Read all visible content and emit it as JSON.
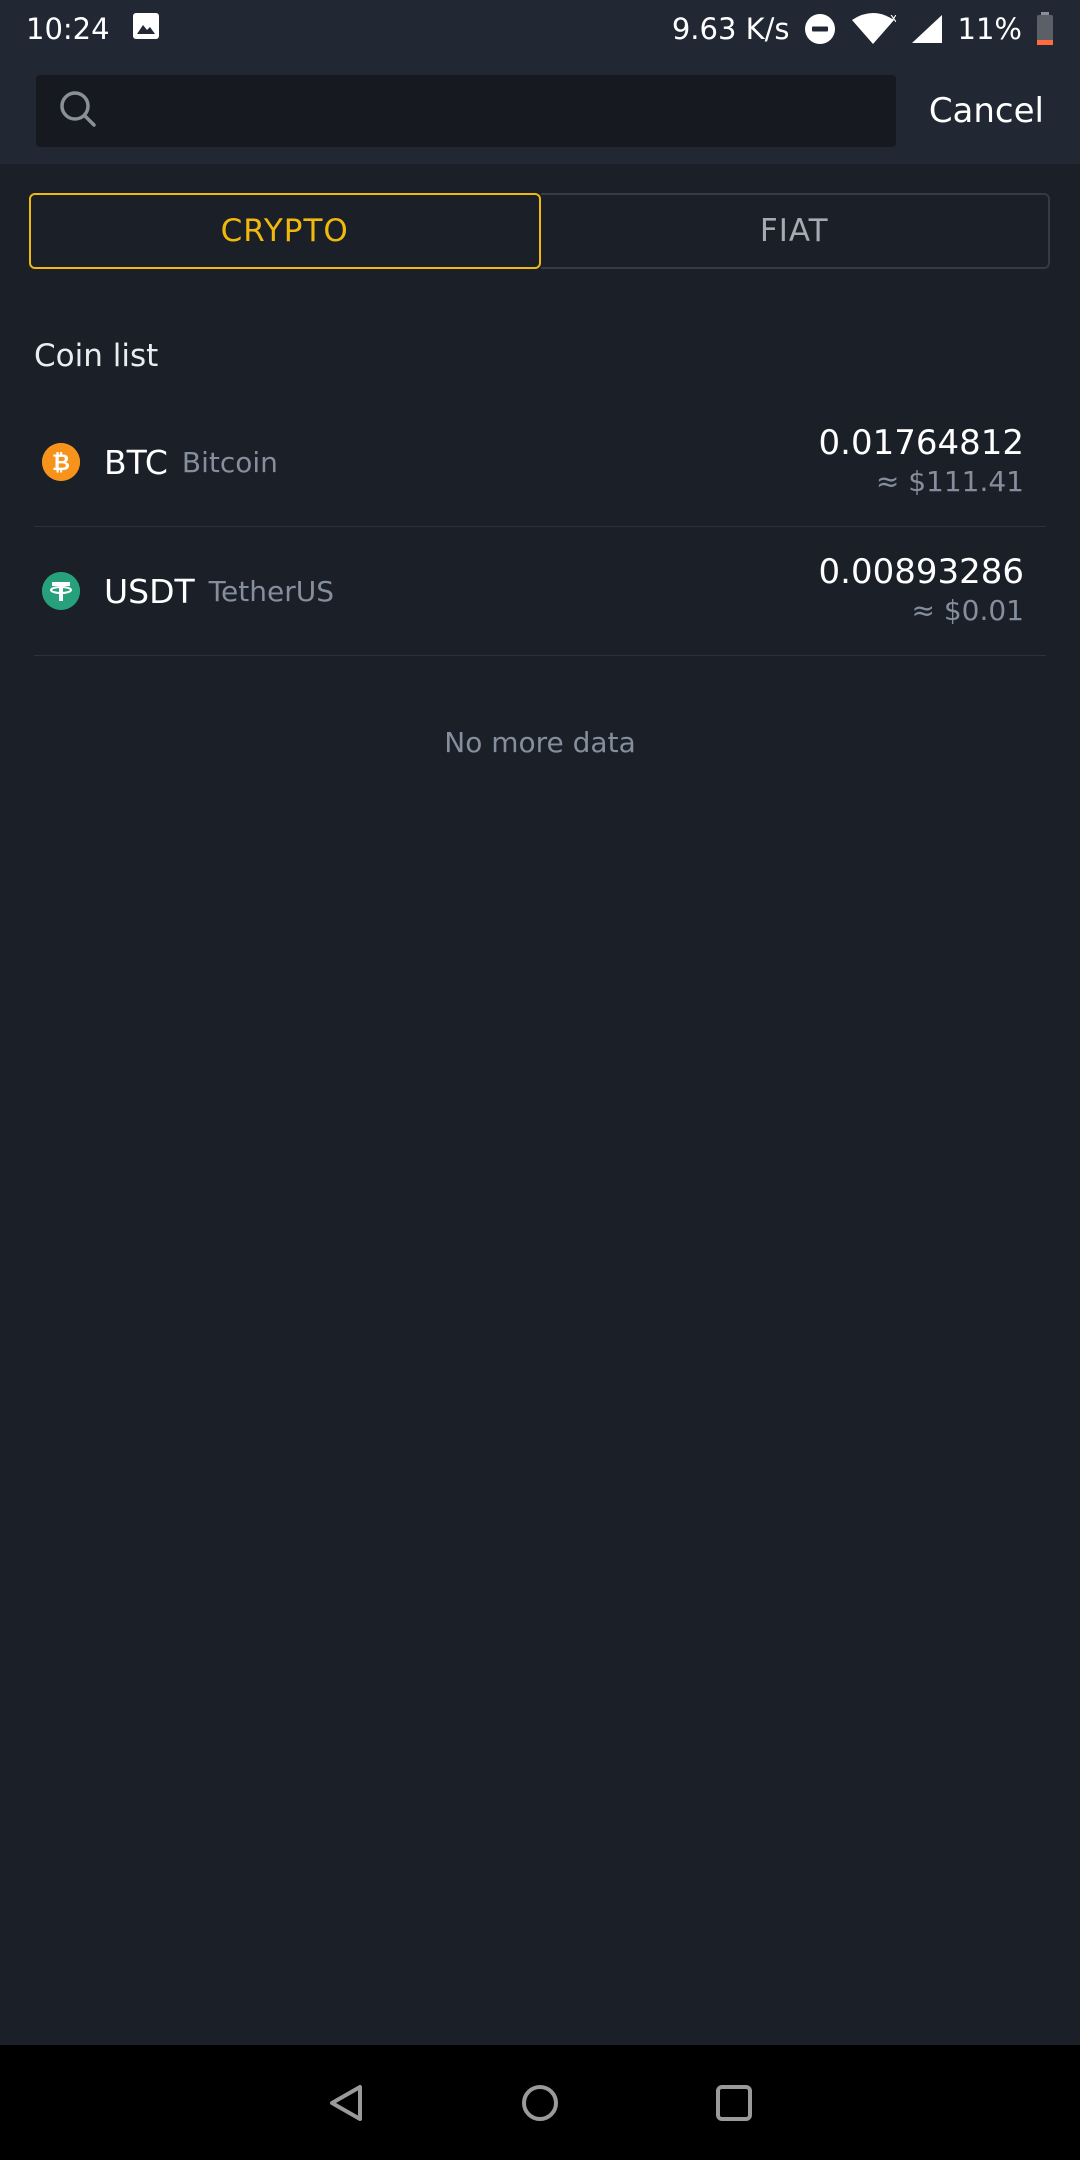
{
  "status_bar": {
    "time": "10:24",
    "net_speed": "9.63 K/s",
    "battery": "11%"
  },
  "search": {
    "placeholder": "",
    "value": "",
    "cancel_label": "Cancel"
  },
  "tabs": [
    {
      "label": "CRYPTO",
      "active": true
    },
    {
      "label": "FIAT",
      "active": false
    }
  ],
  "coin_list": {
    "title": "Coin list",
    "items": [
      {
        "symbol": "BTC",
        "name": "Bitcoin",
        "balance": "0.01764812",
        "fiat": "≈ $111.41",
        "icon": "bitcoin-icon",
        "color": "#f7931a"
      },
      {
        "symbol": "USDT",
        "name": "TetherUS",
        "balance": "0.00893286",
        "fiat": "≈ $0.01",
        "icon": "tether-icon",
        "color": "#26a17b"
      }
    ],
    "empty_text": "No more data"
  },
  "colors": {
    "accent": "#f0b90b",
    "background": "#1a1f28",
    "header": "#212733"
  },
  "icons": [
    "gallery-icon",
    "dnd-icon",
    "wifi-icon",
    "signal-icon",
    "battery-icon",
    "search-icon",
    "back-icon",
    "home-icon",
    "recents-icon"
  ]
}
